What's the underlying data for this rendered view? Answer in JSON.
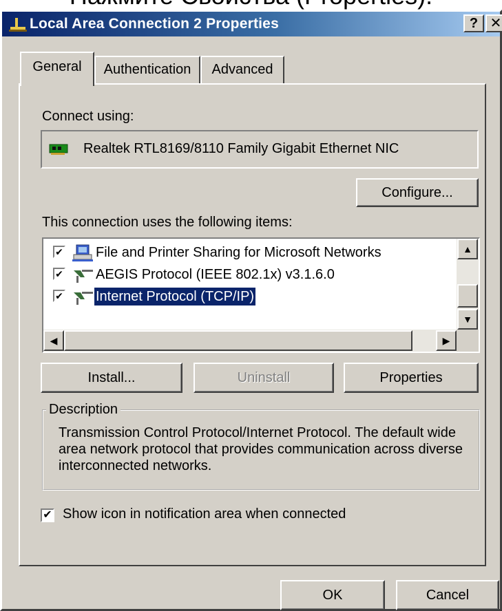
{
  "caption": "Нажмите Свойства (Properties).",
  "window": {
    "title": "Local Area Connection 2 Properties",
    "help_label": "?",
    "close_label": "✕"
  },
  "tabs": [
    {
      "label": "General"
    },
    {
      "label": "Authentication"
    },
    {
      "label": "Advanced"
    }
  ],
  "general": {
    "connect_using_label": "Connect using:",
    "adapter_name": "Realtek RTL8169/8110 Family Gigabit Ethernet NIC",
    "configure_label": "Configure...",
    "items_label": "This connection uses the following items:",
    "items": [
      {
        "label": "File and Printer Sharing for Microsoft Networks",
        "checked": true,
        "icon": "printer-sharing-icon"
      },
      {
        "label": "AEGIS Protocol (IEEE 802.1x) v3.1.6.0",
        "checked": true,
        "icon": "network-protocol-icon"
      },
      {
        "label": "Internet Protocol (TCP/IP)",
        "checked": true,
        "icon": "network-protocol-icon",
        "selected": true
      }
    ],
    "install_label": "Install...",
    "uninstall_label": "Uninstall",
    "properties_label": "Properties",
    "description_legend": "Description",
    "description_text": "Transmission Control Protocol/Internet Protocol. The default wide area network protocol that provides communication across diverse interconnected networks.",
    "notify_label": "Show icon in notification area when connected",
    "notify_checked": true
  },
  "footer": {
    "ok_label": "OK",
    "cancel_label": "Cancel"
  },
  "colors": {
    "title_start": "#0a246a",
    "title_end": "#a6caf0",
    "face": "#d4d0c8",
    "selection": "#0a246a"
  },
  "check_glyph": "✔"
}
